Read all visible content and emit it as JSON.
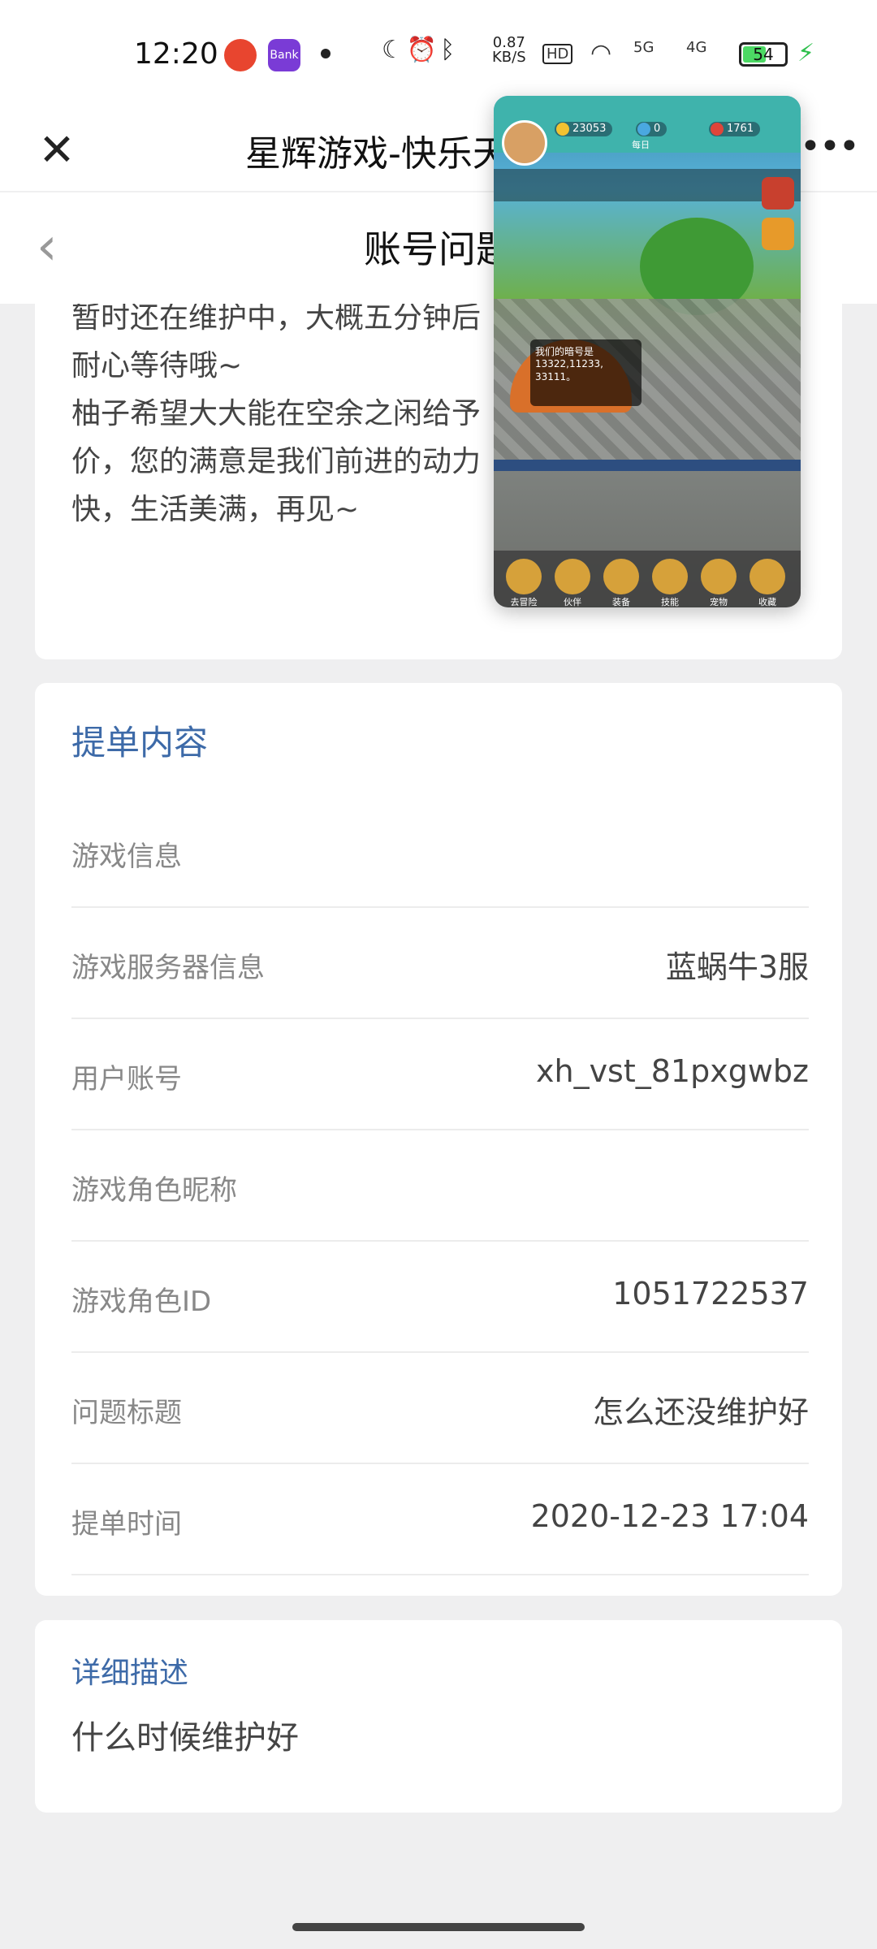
{
  "status_bar": {
    "time": "12:20",
    "net_speed_value": "0.87",
    "net_speed_unit": "KB/S",
    "hd": "HD",
    "signal_5g": "5G",
    "signal_4g": "4G",
    "battery": "54",
    "app2_label": "Bank"
  },
  "header": {
    "title": "星辉游戏-快乐天"
  },
  "subheader": {
    "title": "账号问题"
  },
  "reply": {
    "lines": [
      "暂时还在维护中，大概五分钟后",
      "耐心等待哦~",
      "柚子希望大大能在空余之闲给予",
      "价，您的满意是我们前进的动力",
      "快，生活美满，再见~"
    ]
  },
  "ticket": {
    "section_title": "提单内容",
    "rows": [
      {
        "label": "游戏信息",
        "value": ""
      },
      {
        "label": "游戏服务器信息",
        "value": "蓝蜗牛3服"
      },
      {
        "label": "用户账号",
        "value": "xh_vst_81pxgwbz"
      },
      {
        "label": "游戏角色昵称",
        "value": ""
      },
      {
        "label": "游戏角色ID",
        "value": "1051722537"
      },
      {
        "label": "问题标题",
        "value": "怎么还没维护好"
      },
      {
        "label": "提单时间",
        "value": "2020-12-23 17:04"
      }
    ]
  },
  "description": {
    "title": "详细描述",
    "text": "什么时候维护好"
  },
  "game_window": {
    "res_gold": "23053",
    "res_gem": "0",
    "res_heart": "1761",
    "daily_label": "每日",
    "chat_text": "我们的暗号是 13322,11233, 33111。",
    "bottom_labels": [
      "去冒险",
      "伙伴",
      "装备",
      "技能",
      "宠物",
      "收藏"
    ]
  },
  "colors": {
    "accent": "#3d6aa8",
    "background": "#efeff0"
  }
}
